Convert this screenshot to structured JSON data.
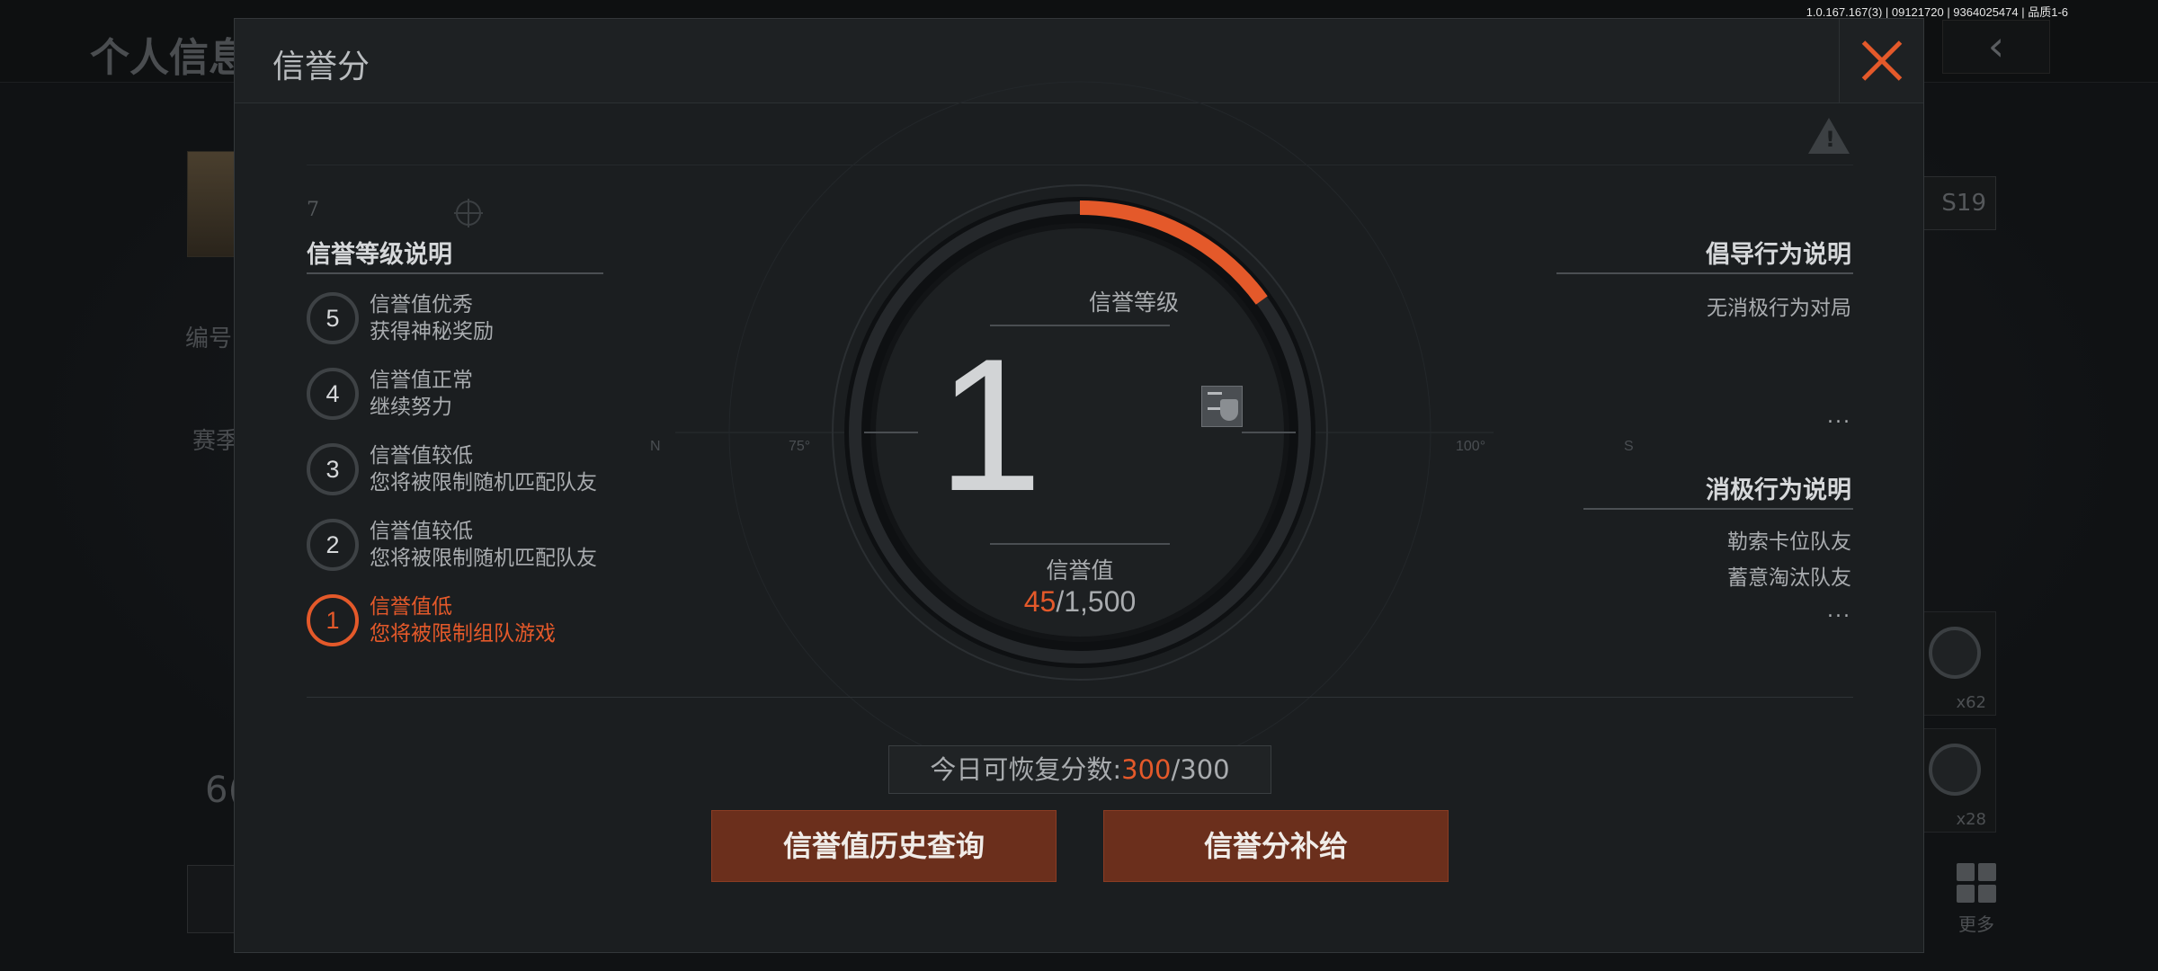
{
  "version_text": "1.0.167.167(3) | 09121720 | 9364025474 | 品质1-6",
  "background": {
    "page_title": "个人信息",
    "back_label": "‹",
    "season_badge": "S19",
    "left_labels": [
      "编号:",
      "赛季",
      "6("
    ],
    "medals": [
      {
        "count": "x62"
      },
      {
        "count": "x28"
      }
    ],
    "more_label": "更多"
  },
  "modal": {
    "title": "信誉分",
    "left": {
      "heading": "信誉等级说明",
      "deco_number": "7",
      "levels": [
        {
          "num": "5",
          "title": "信誉值优秀",
          "desc": "获得神秘奖励"
        },
        {
          "num": "4",
          "title": "信誉值正常",
          "desc": "继续努力"
        },
        {
          "num": "3",
          "title": "信誉值较低",
          "desc": "您将被限制随机匹配队友"
        },
        {
          "num": "2",
          "title": "信誉值较低",
          "desc": "您将被限制随机匹配队友"
        },
        {
          "num": "1",
          "title": "信誉值低",
          "desc": "您将被限制组队游戏"
        }
      ],
      "active_level": "1"
    },
    "dial": {
      "level_label": "信誉等级",
      "level_value": "1",
      "score_label": "信誉值",
      "score_current": "45",
      "score_max": "/1,500",
      "score_fraction": 0.03,
      "compass_labels": [
        "N",
        "75°",
        "100°",
        "S"
      ]
    },
    "right": {
      "encourage_heading": "倡导行为说明",
      "encourage_items": [
        "无消极行为对局"
      ],
      "encourage_more": "...",
      "negative_heading": "消极行为说明",
      "negative_items": [
        "勒索卡位队友",
        "蓄意淘汰队友"
      ],
      "negative_more": "..."
    },
    "recover": {
      "label": "今日可恢复分数:",
      "current": "300",
      "max": "/300"
    },
    "buttons": {
      "history": "信誉值历史查询",
      "supply": "信誉分补给"
    },
    "colors": {
      "accent": "#e4592a",
      "button_bg": "#6b2f1c"
    }
  }
}
